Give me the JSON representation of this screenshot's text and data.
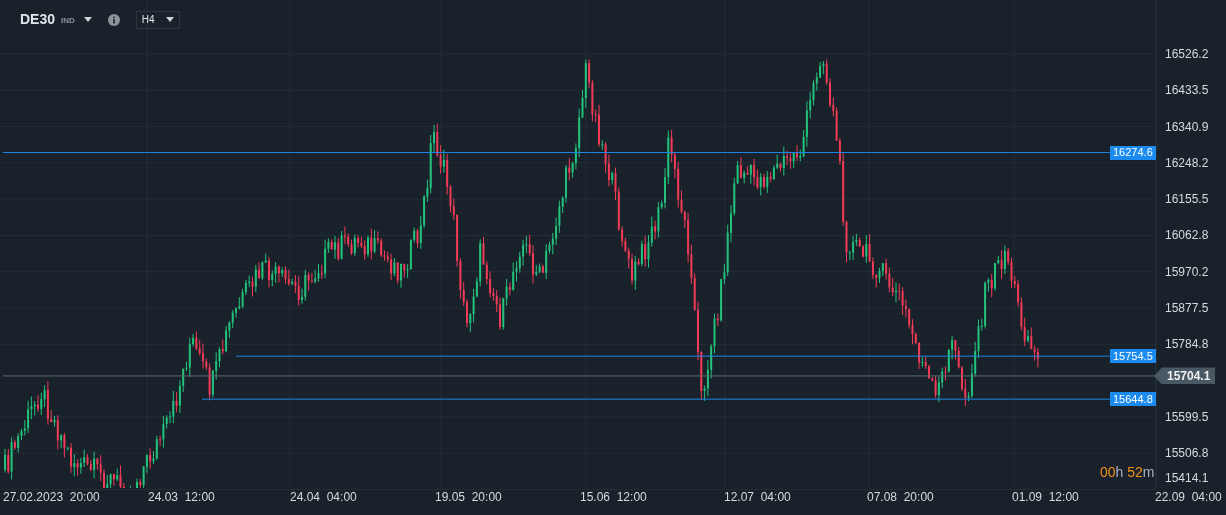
{
  "instrument": {
    "symbol": "DE30",
    "type": "IND"
  },
  "timeframe": "H4",
  "price_axis": [
    "16526.2",
    "16433.5",
    "16340.9",
    "16248.2",
    "16155.5",
    "16062.8",
    "15970.2",
    "15877.5",
    "15784.8",
    "15599.5",
    "15506.8",
    "15414.1"
  ],
  "time_axis": [
    "27.02.2023  20:00",
    "24.03  12:00",
    "24.04  04:00",
    "19.05  20:00",
    "15.06  12:00",
    "12.07  04:00",
    "07.08  20:00",
    "01.09  12:00",
    "22.09  04:00"
  ],
  "levels": [
    {
      "label": "16274.6"
    },
    {
      "label": "15754.5"
    },
    {
      "label": "15644.8"
    }
  ],
  "current_price": "15704.1",
  "countdown": {
    "hours": "00",
    "hours_unit": "h",
    "minutes": "52",
    "minutes_unit": "m"
  }
}
